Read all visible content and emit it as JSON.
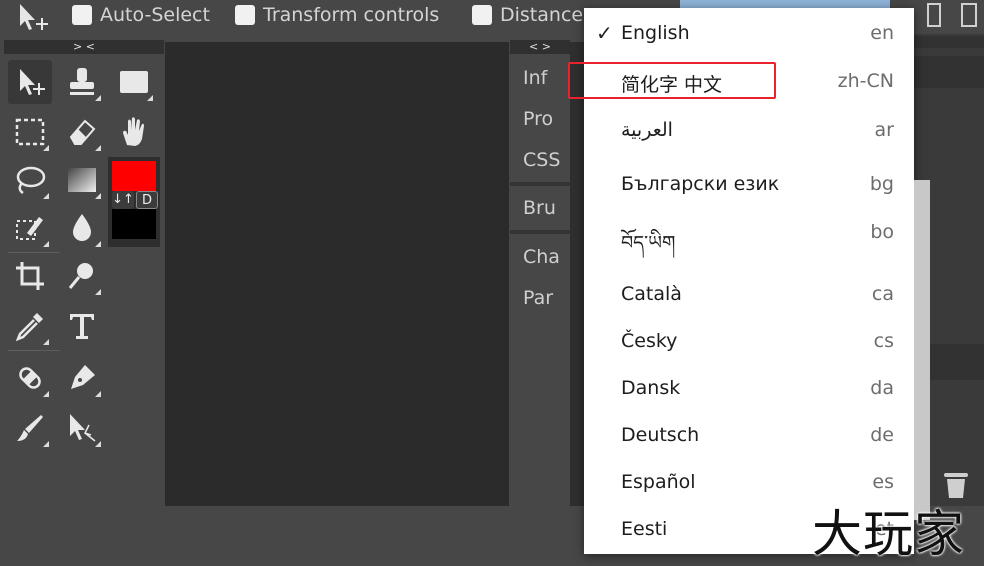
{
  "toolbar": {
    "options": [
      {
        "label": "Auto-Select",
        "checked": false
      },
      {
        "label": "Transform controls",
        "checked": false
      },
      {
        "label": "Distances",
        "checked": false
      }
    ]
  },
  "tools_panel": {
    "collapse_label": "> <",
    "tools": [
      "move-tool",
      "stamp-tool",
      "frame-tool",
      "marquee-tool",
      "eraser-tool",
      "hand-tool",
      "lasso-tool",
      "gradient-tool",
      "zoom-tool",
      "quick-select-tool",
      "blur-tool",
      "crop-tool",
      "dodge-tool",
      "eyedropper-tool",
      "type-tool",
      "healing-tool",
      "pen-tool",
      "brush-tool",
      "path-select-tool"
    ],
    "colors": {
      "foreground": "#ff0000",
      "background": "#000000",
      "swap_label": "↓↑",
      "default_label": "D"
    }
  },
  "side_panel": {
    "collapse_label": "< >",
    "tabs": [
      "Inf",
      "Pro",
      "CSS",
      "Bru",
      "Cha",
      "Par"
    ]
  },
  "language_menu": {
    "items": [
      {
        "name": "English",
        "code": "en",
        "selected": true
      },
      {
        "name": "简化字 中文",
        "code": "zh-CN",
        "selected": false
      },
      {
        "name": "العربية",
        "code": "ar",
        "selected": false
      },
      {
        "name": "Български език",
        "code": "bg",
        "selected": false
      },
      {
        "name": "བོད་ཡིག",
        "code": "bo",
        "selected": false
      },
      {
        "name": "Català",
        "code": "ca",
        "selected": false
      },
      {
        "name": "Česky",
        "code": "cs",
        "selected": false
      },
      {
        "name": "Dansk",
        "code": "da",
        "selected": false
      },
      {
        "name": "Deutsch",
        "code": "de",
        "selected": false
      },
      {
        "name": "Español",
        "code": "es",
        "selected": false
      },
      {
        "name": "Eesti",
        "code": "et",
        "selected": false
      }
    ],
    "check_mark": "✓"
  },
  "watermark": "大玩家",
  "accent_colors": {
    "highlight": "#e8232c",
    "menu_button": "#8fb3d9"
  }
}
